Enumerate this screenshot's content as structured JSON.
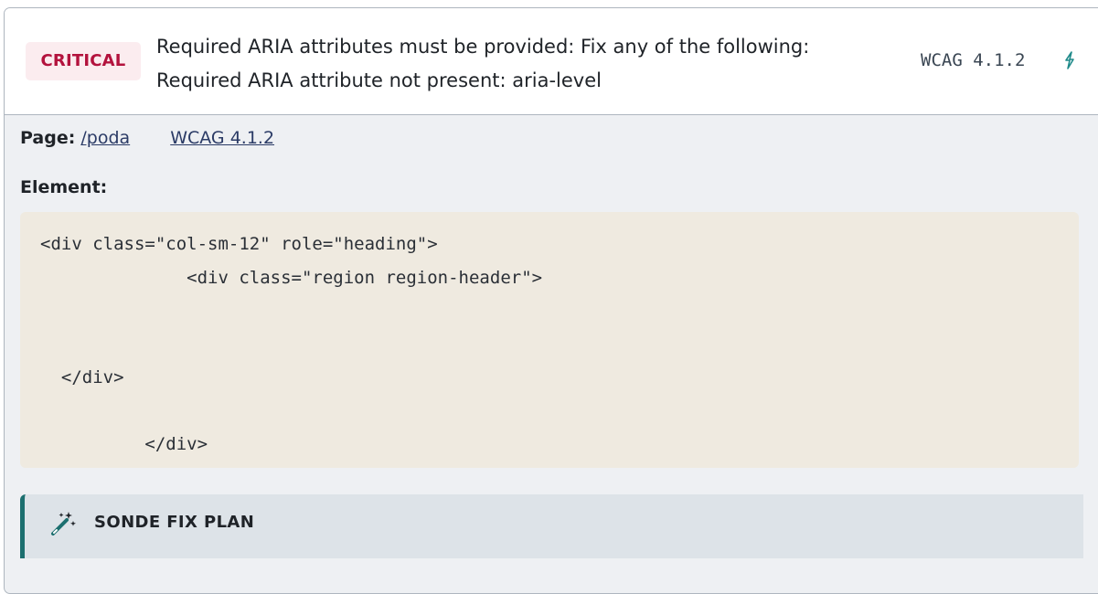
{
  "issue": {
    "severity": "CRITICAL",
    "title_line1": "Required ARIA attributes must be provided: Fix any of the following:",
    "title_line2": "Required ARIA attribute not present: aria-level",
    "wcag_code": "WCAG 4.1.2",
    "link_icon": "⚡"
  },
  "details": {
    "page_label": "Page:",
    "page_value": "/poda",
    "wcag_link": "WCAG 4.1.2",
    "element_label": "Element:"
  },
  "code": {
    "lines": [
      "<div class=\"col-sm-12\" role=\"heading\">",
      "              <div class=\"region region-header\">",
      "  </div>",
      "          </div>"
    ]
  },
  "fix_plan": {
    "label": "SONDE FIX PLAN",
    "icon": "magic-wand-icon"
  },
  "colors": {
    "critical": "#b3123d",
    "critical_bg": "#fbecef",
    "accent": "#1c6f6f",
    "link": "#2b3b66"
  }
}
